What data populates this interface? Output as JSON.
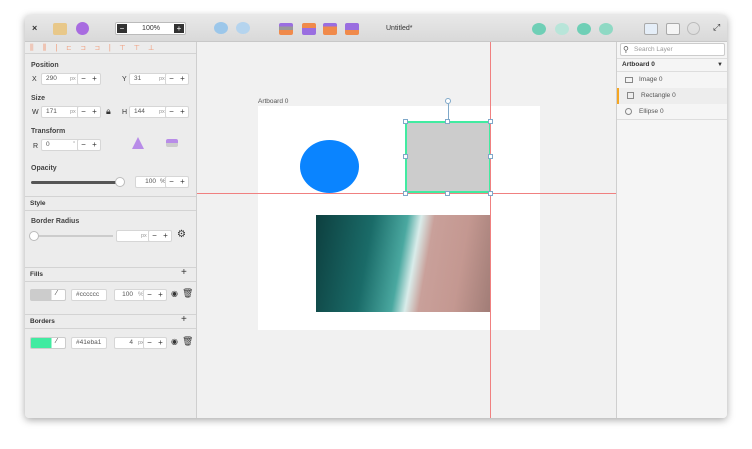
{
  "toolbar": {
    "zoom": "100%",
    "zoom_minus": "−",
    "zoom_plus": "+",
    "title": "Untitled*",
    "close": "×"
  },
  "colors": {
    "accent": "#f5a623",
    "fill": "#cccccc",
    "border": "#41eba1",
    "ellipse": "#0a84ff",
    "guide": "#f08080"
  },
  "position": {
    "label": "Position",
    "x_label": "X",
    "x": "290",
    "y_label": "Y",
    "y": "31",
    "unit": "px"
  },
  "size": {
    "label": "Size",
    "w_label": "W",
    "w": "171",
    "h_label": "H",
    "h": "144",
    "unit": "px"
  },
  "transform": {
    "label": "Transform",
    "r_label": "R",
    "r": "0",
    "unit": "°"
  },
  "opacity": {
    "label": "Opacity",
    "value": "100",
    "unit": "%",
    "level": 100
  },
  "style": {
    "label": "Style",
    "border_radius_label": "Border Radius",
    "unit": "px",
    "level": 0
  },
  "fills": {
    "label": "Fills",
    "add": "+",
    "color": "#cccccc",
    "opacity": "100",
    "unit": "%"
  },
  "borders": {
    "label": "Borders",
    "add": "+",
    "color": "#41eba1",
    "width": "4",
    "unit": "px"
  },
  "canvas": {
    "artboard_label": "Artboard 0"
  },
  "layers": {
    "search_placeholder": "Search Layer",
    "artboard": "Artboard 0",
    "items": [
      {
        "label": "Image 0",
        "icon": "image-icon"
      },
      {
        "label": "Rectangle 0",
        "icon": "square-icon",
        "selected": true
      },
      {
        "label": "Ellipse 0",
        "icon": "circle-icon"
      }
    ]
  }
}
